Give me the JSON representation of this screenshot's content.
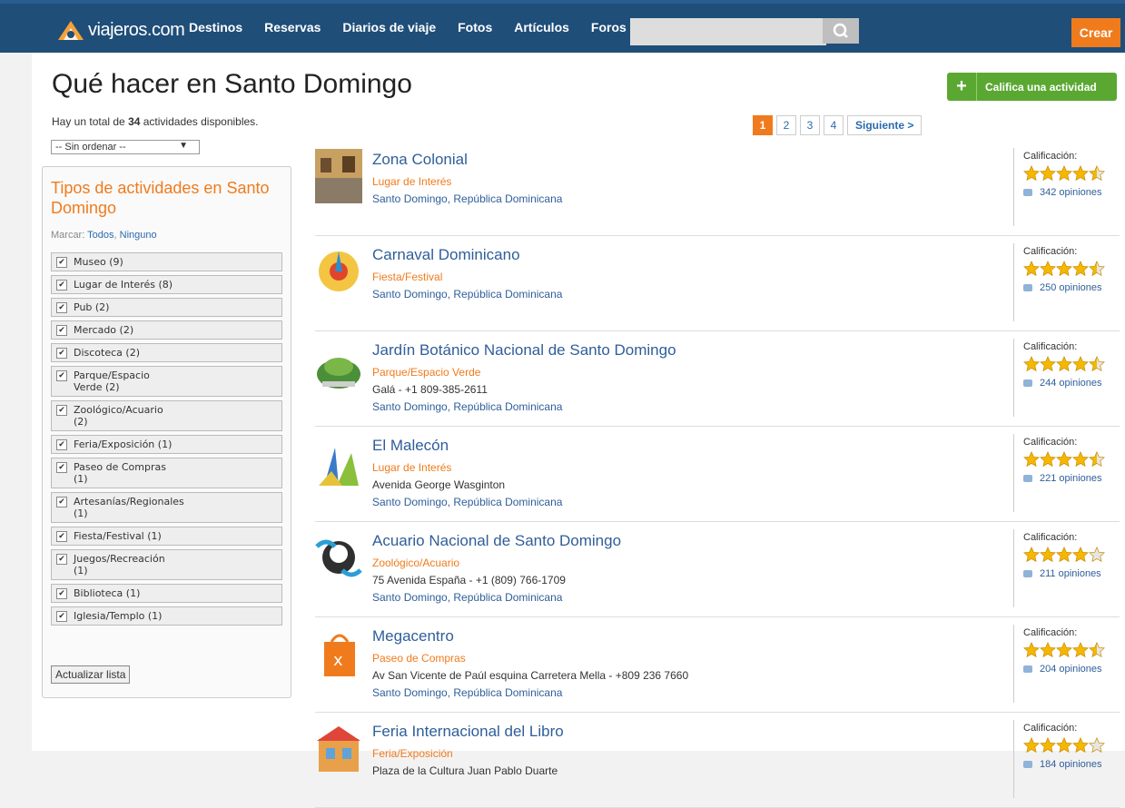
{
  "topbar": {
    "logo": "viajeros.com",
    "nav": [
      "Destinos",
      "Reservas",
      "Diarios de viaje",
      "Fotos",
      "Artículos",
      "Foros"
    ],
    "search_placeholder": "",
    "create": "Crear"
  },
  "page": {
    "title": "Qué hacer en Santo Domingo",
    "rate_button": "Califica una actividad",
    "total_prefix": "Hay un total de ",
    "total_count": "34",
    "total_suffix": " actividades disponibles.",
    "sort_value": "-- Sin ordenar --"
  },
  "pager": {
    "pages": [
      "1",
      "2",
      "3",
      "4"
    ],
    "next": "Siguiente >",
    "current": "1"
  },
  "filters": {
    "title": "Tipos de actividades en Santo Domingo",
    "mark_label": "Marcar:",
    "mark_all": "Todos",
    "mark_none": "Ninguno",
    "items": [
      "Museo (9)",
      "Lugar de Interés (8)",
      "Pub (2)",
      "Mercado (2)",
      "Discoteca (2)",
      "Parque/Espacio Verde (2)",
      "Zoológico/Acuario (2)",
      "Feria/Exposición (1)",
      "Paseo de Compras (1)",
      "Artesanías/Regionales (1)",
      "Fiesta/Festival (1)",
      "Juegos/Recreación (1)",
      "Biblioteca (1)",
      "Iglesia/Templo (1)"
    ],
    "update_button": "Actualizar lista"
  },
  "rating_label": "Calificación:",
  "results": [
    {
      "title": "Zona Colonial",
      "category": "Lugar de Interés",
      "address": "",
      "location": "Santo Domingo, República Dominicana",
      "stars": 4.5,
      "opinions": "342 opiniones"
    },
    {
      "title": "Carnaval Dominicano",
      "category": "Fiesta/Festival",
      "address": "",
      "location": "Santo Domingo, República Dominicana",
      "stars": 4.5,
      "opinions": "250 opiniones"
    },
    {
      "title": "Jardín Botánico Nacional de Santo Domingo",
      "category": "Parque/Espacio Verde",
      "address": "Galá - +1 809-385-2611",
      "location": "Santo Domingo, República Dominicana",
      "stars": 4.5,
      "opinions": "244 opiniones"
    },
    {
      "title": "El Malecón",
      "category": "Lugar de Interés",
      "address": "Avenida George Wasginton",
      "location": "Santo Domingo, República Dominicana",
      "stars": 4.5,
      "opinions": "221 opiniones"
    },
    {
      "title": "Acuario Nacional de Santo Domingo",
      "category": "Zoológico/Acuario",
      "address": "75 Avenida España - +1 (809) 766-1709",
      "location": "Santo Domingo, República Dominicana",
      "stars": 4,
      "opinions": "211 opiniones"
    },
    {
      "title": "Megacentro",
      "category": "Paseo de Compras",
      "address": "Av San Vicente de Paúl esquina Carretera Mella - +809 236 7660",
      "location": "Santo Domingo, República Dominicana",
      "stars": 4.5,
      "opinions": "204 opiniones"
    },
    {
      "title": "Feria Internacional del Libro",
      "category": "Feria/Exposición",
      "address": "Plaza de la Cultura Juan Pablo Duarte",
      "location": "",
      "stars": 4,
      "opinions": "184 opiniones"
    }
  ],
  "colors": {
    "topbar": "#1f4e79",
    "accent": "#f07b1d",
    "link": "#2f5e99",
    "green": "#5aa832"
  },
  "icons": [
    "search-icon",
    "plus-icon",
    "checkbox-icon",
    "star-icon",
    "comment-icon"
  ]
}
